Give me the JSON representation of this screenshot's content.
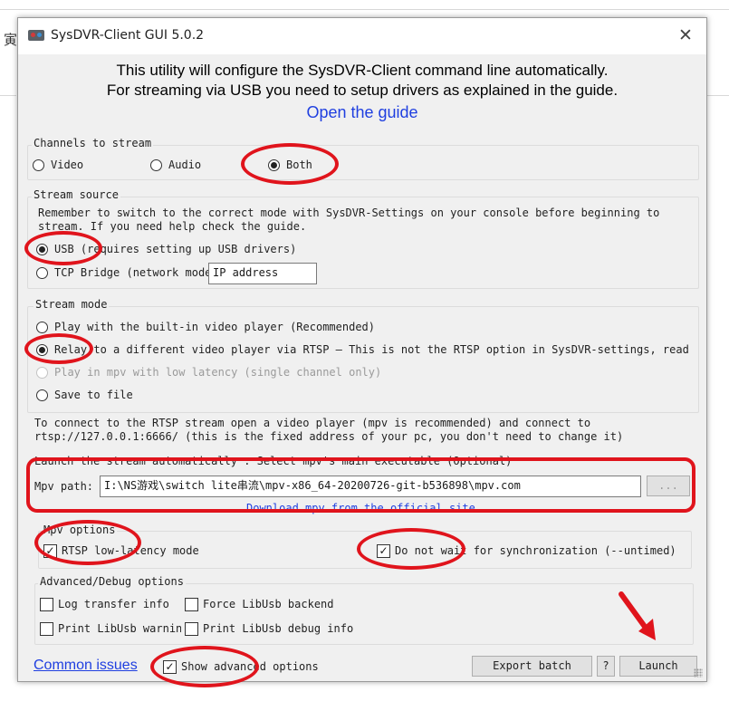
{
  "background": {
    "char": "寅"
  },
  "window": {
    "title": "SysDVR-Client GUI 5.0.2",
    "close_glyph": "✕"
  },
  "intro": {
    "line1": "This utility will configure the SysDVR-Client command line automatically.",
    "line2": "For streaming via USB you need to setup drivers as explained in the guide.",
    "guide_link": "Open the guide"
  },
  "channels": {
    "title": "Channels to stream",
    "options": [
      {
        "label": "Video",
        "selected": false
      },
      {
        "label": "Audio",
        "selected": false
      },
      {
        "label": "Both",
        "selected": true
      }
    ]
  },
  "source": {
    "title": "Stream source",
    "note1": "Remember to switch to the correct mode with SysDVR-Settings on your console before beginning to",
    "note2": "stream. If you need help check the guide.",
    "usb_label": "USB (requires setting up USB drivers)",
    "usb_selected": true,
    "tcp_label": "TCP Bridge (network mode)",
    "tcp_selected": false,
    "ip_placeholder": "IP address"
  },
  "mode": {
    "title": "Stream mode",
    "options": [
      {
        "label": "Play with the built-in video player (Recommended)",
        "selected": false,
        "disabled": false
      },
      {
        "label": "Relay to a different video player via RTSP — This is not the RTSP option in SysDVR-settings, read",
        "selected": true,
        "disabled": false
      },
      {
        "label": "Play in mpv with low latency (single channel only)",
        "selected": false,
        "disabled": true
      },
      {
        "label": "Save to file",
        "selected": false,
        "disabled": false
      }
    ]
  },
  "rtsp": {
    "info1": "To connect to the RTSP stream open a video player (mpv is recommended) and connect to",
    "info2": "rtsp://127.0.0.1:6666/ (this is the fixed address of your pc, you don't need to change it)",
    "launch_label": "Launch the stream automatically : Select mpv's main executable (Optional)",
    "mpv_path_label": "Mpv path:",
    "mpv_path_value": "I:\\NS游戏\\switch lite串流\\mpv-x86_64-20200726-git-b536898\\mpv.com",
    "browse_label": "...",
    "download_link": "Download mpv from the official site"
  },
  "mpv_options": {
    "title": "Mpv options",
    "rtsp_low_latency": {
      "label": "RTSP low-latency mode",
      "checked": true
    },
    "no_wait_sync": {
      "label": "Do not wait for synchronization (--untimed)",
      "checked": true
    }
  },
  "advanced": {
    "title": "Advanced/Debug options",
    "log_transfer": {
      "label": "Log transfer info",
      "checked": false
    },
    "force_libusb": {
      "label": "Force LibUsb backend",
      "checked": false
    },
    "print_libusb_warn": {
      "label": "Print LibUsb warnings",
      "checked": false
    },
    "print_libusb_debug": {
      "label": "Print LibUsb debug info",
      "checked": false
    }
  },
  "footer": {
    "common_issues": "Common issues",
    "show_advanced": {
      "label": "Show advanced options",
      "checked": true
    },
    "export_batch": "Export batch",
    "help": "?",
    "launch": "Launch"
  },
  "check_glyph": "✓",
  "annotation_color": "#e0141c"
}
